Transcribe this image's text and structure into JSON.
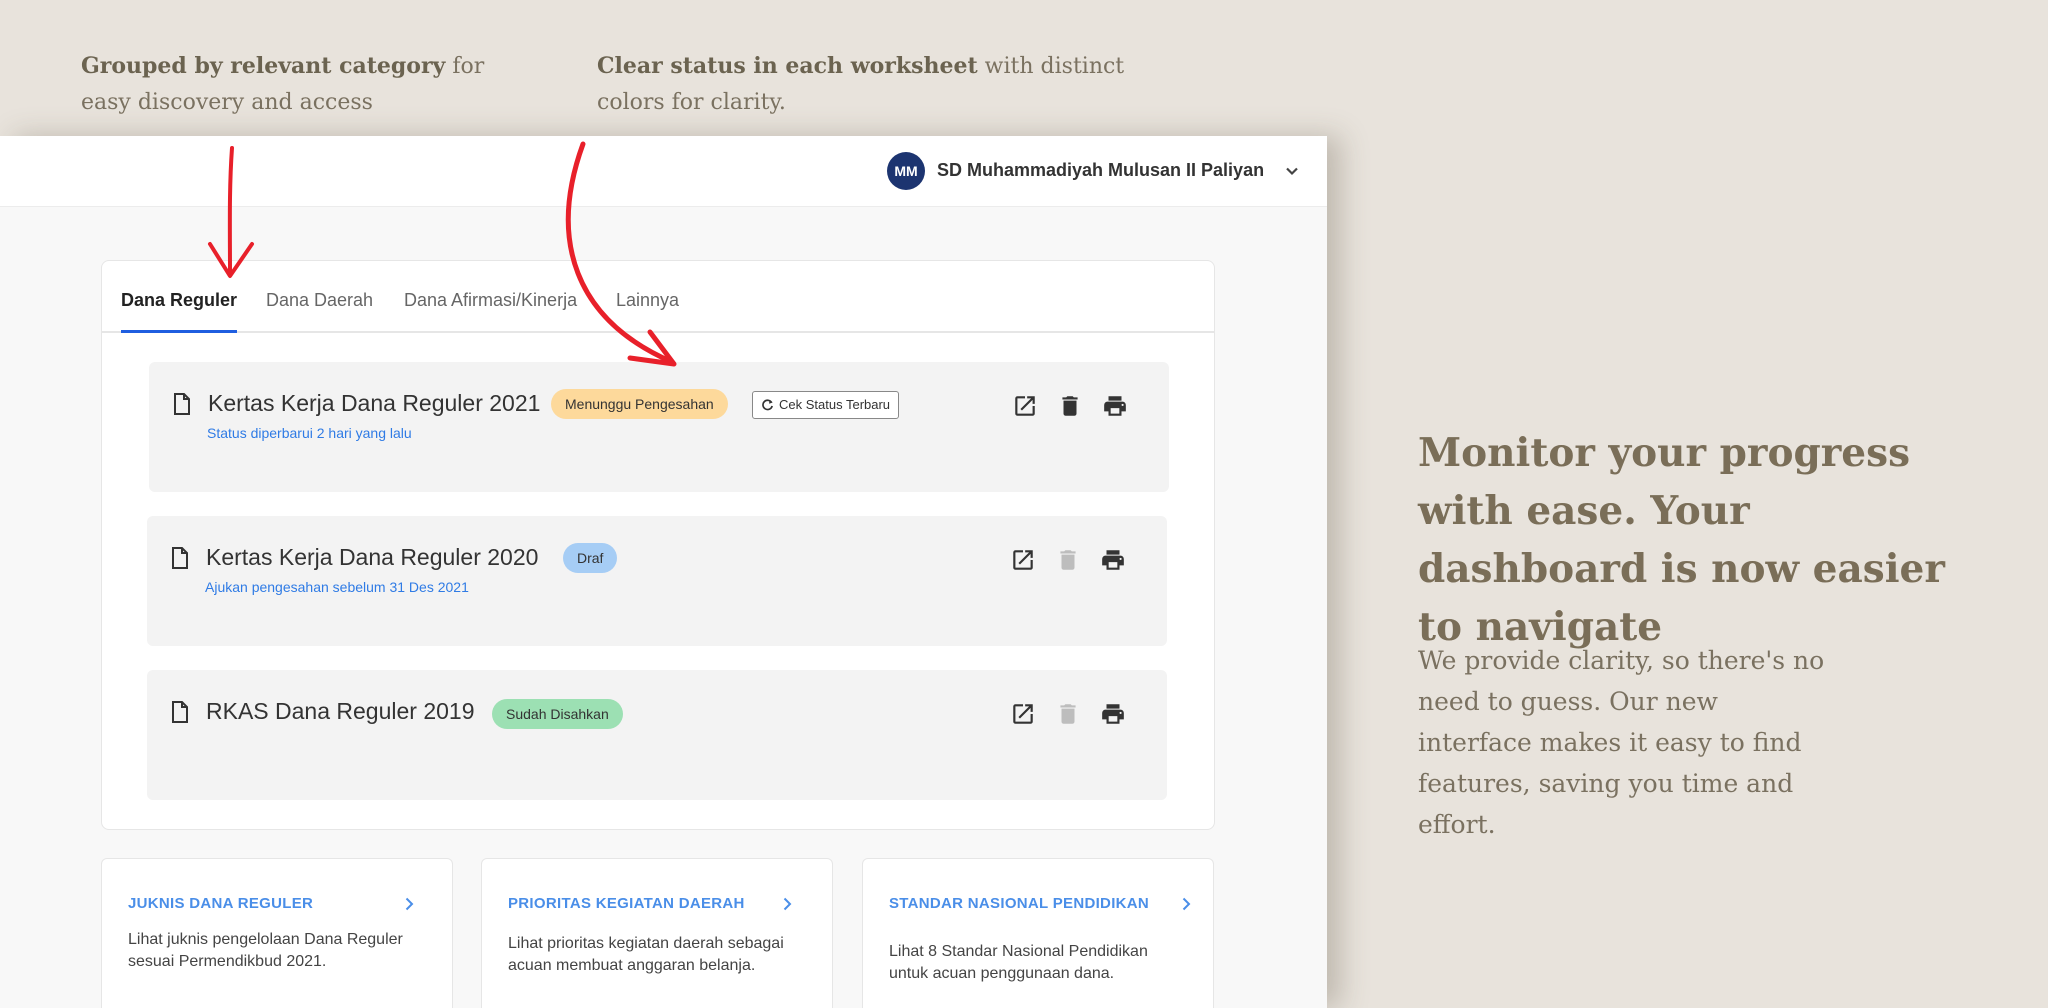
{
  "annotations": {
    "left": {
      "bold": "Grouped by relevant category",
      "rest": " for easy discovery and access"
    },
    "right": {
      "bold": "Clear status in each worksheet",
      "rest": " with distinct colors for clarity."
    }
  },
  "header": {
    "avatar_initials": "MM",
    "school_name": "SD Muhammadiyah Mulusan II Paliyan",
    "dropdown_icon": "chevron-down-icon"
  },
  "tabs": [
    {
      "label": "Dana Reguler",
      "active": true
    },
    {
      "label": "Dana Daerah",
      "active": false
    },
    {
      "label": "Dana Afirmasi/Kinerja",
      "active": false
    },
    {
      "label": "Lainnya",
      "active": false
    }
  ],
  "worksheets": [
    {
      "title": "Kertas Kerja Dana Reguler 2021",
      "status": "Menunggu Pengesahan",
      "status_color": "#fdd99b",
      "subtitle": "Status diperbarui 2 hari yang lalu",
      "check_button": "Cek Status Terbaru",
      "delete_enabled": true
    },
    {
      "title": "Kertas Kerja Dana Reguler 2020",
      "status": "Draf",
      "status_color": "#a6cdf5",
      "subtitle": "Ajukan pengesahan sebelum 31 Des 2021",
      "delete_enabled": false
    },
    {
      "title": "RKAS Dana Reguler 2019",
      "status": "Sudah Disahkan",
      "status_color": "#9ce0b3",
      "subtitle": "",
      "delete_enabled": false
    }
  ],
  "info_cards": [
    {
      "title": "JUKNIS DANA REGULER",
      "desc": "Lihat juknis pengelolaan Dana Reguler sesuai Permendikbud 2021."
    },
    {
      "title": "PRIORITAS KEGIATAN DAERAH",
      "desc": "Lihat prioritas kegiatan daerah sebagai acuan membuat anggaran belanja."
    },
    {
      "title": "STANDAR NASIONAL PENDIDIKAN",
      "desc": "Lihat 8 Standar Nasional Pendidikan untuk acuan penggunaan dana."
    }
  ],
  "side_copy": {
    "headline": "Monitor your progress with ease. Your dashboard is now easier to navigate",
    "body": "We provide clarity, so there's no need to guess. Our new interface makes it easy to find features, saving you time and effort."
  },
  "colors": {
    "background": "#e8e3dc",
    "accent_tab": "#1f5ee0",
    "link_blue": "#2f7be5",
    "arrow_red": "#e8202a",
    "avatar_navy": "#1c3470"
  }
}
